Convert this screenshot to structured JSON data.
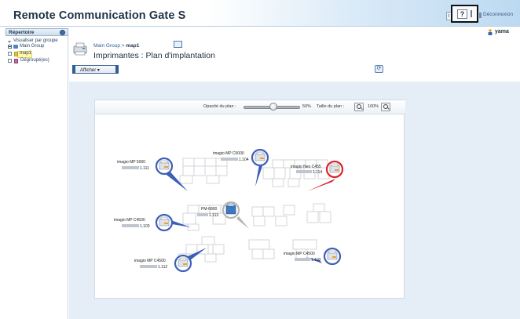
{
  "header": {
    "app_title": "Remote Communication Gate S",
    "small_button": "i",
    "help_label": "?",
    "logout_label": "Déconnexion"
  },
  "user": {
    "name": "yama"
  },
  "sidebar": {
    "title": "Répertoire",
    "view_by_group": "Visualiser par groupe",
    "tree": [
      {
        "label": "Main Group"
      },
      {
        "label": "map1"
      },
      {
        "label": "Dégroupé(es)"
      }
    ]
  },
  "main": {
    "breadcrumb_link": "Main Group",
    "breadcrumb_separator": " > ",
    "breadcrumb_current": "map1",
    "title": "Imprimantes : Plan d'implantation",
    "display_button": "Afficher ▾",
    "refresh_icon": "refresh-icon"
  },
  "toolbar": {
    "opacity_label": "Opacité du plan :",
    "opacity_value": "50%",
    "opacity_fraction": 0.5,
    "size_label": "Taille du plan :",
    "zoom_value": "100%"
  },
  "printers": [
    {
      "name": "imagio MP 5000",
      "ip_suffix": "1.111",
      "ring": "#3d5fb8"
    },
    {
      "name": "imagio MP C5000",
      "ip_suffix": "1.104",
      "ring": "#3d5fb8"
    },
    {
      "name": "imagio Neo C455",
      "ip_suffix": "1.114",
      "ring": "#d9242a"
    },
    {
      "name": "imagio MP C4500",
      "ip_suffix": "1.103",
      "ring": "#3d5fb8"
    },
    {
      "name": "PM-6800",
      "ip_suffix": "1.113",
      "ring": "#b5b5b5"
    },
    {
      "name": "imagio MP C4500",
      "ip_suffix": "1.112",
      "ring": "#3d5fb8"
    },
    {
      "name": "imagio MP C4500",
      "ip_suffix": "1.102",
      "ring": "#3d5fb8"
    }
  ]
}
